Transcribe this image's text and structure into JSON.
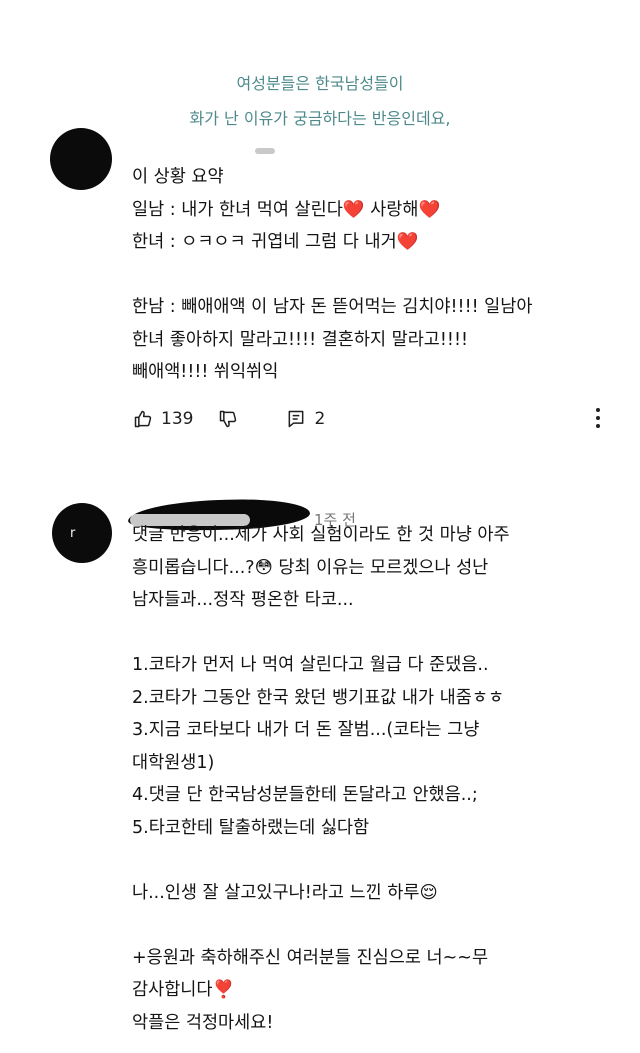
{
  "caption": {
    "line1": "여성분들은 한국남성들이",
    "line2": "화가 난 이유가 궁금하다는 반응인데요,"
  },
  "comment1": {
    "text": "이 상황 요약\n일남 : 내가 한녀 먹여 살린다❤️ 사랑해❤️\n한녀 : ㅇㅋㅇㅋ 귀엽네 그럼 다 내거❤️\n\n한남 : 빼애애액 이 남자 돈 뜯어먹는 김치야!!!! 일남아\n한녀 좋아하지 말라고!!!! 결혼하지 말라고!!!!\n빼애액!!!! 쒸익쒸익",
    "likes": "139",
    "replies": "2"
  },
  "comment2": {
    "time": "1주 전",
    "text": "댓글 반응이...제가 사회 실험이라도 한 것 마냥 아주\n흥미롭습니다...?😳 당최 이유는 모르겠으나 성난\n남자들과...정작 평온한 타코...\n\n1.코타가 먼저 나 먹여 살린다고 월급 다 준댔음..\n2.코타가 그동안 한국 왔던 뱅기표값 내가 내줌ㅎㅎ\n3.지금 코타보다 내가 더 돈 잘범...(코타는 그냥\n대학원생1)\n4.댓글 단 한국남성분들한테 돈달라고 안했음..;\n5.타코한테 탈출하랬는데 싫다함\n\n나...인생 잘 살고있구나!라고 느낀 하루😌\n\n+응원과 축하해주신 여러분들 진심으로 너~~무\n감사합니다❣️\n악플은 걱정마세요!"
  },
  "icons": {
    "like": "thumbs-up-icon",
    "dislike": "thumbs-down-icon",
    "reply": "comment-icon",
    "more": "more-vertical-icon"
  },
  "colors": {
    "caption": "#4e8a8c",
    "text": "#141414",
    "muted": "#777777"
  }
}
